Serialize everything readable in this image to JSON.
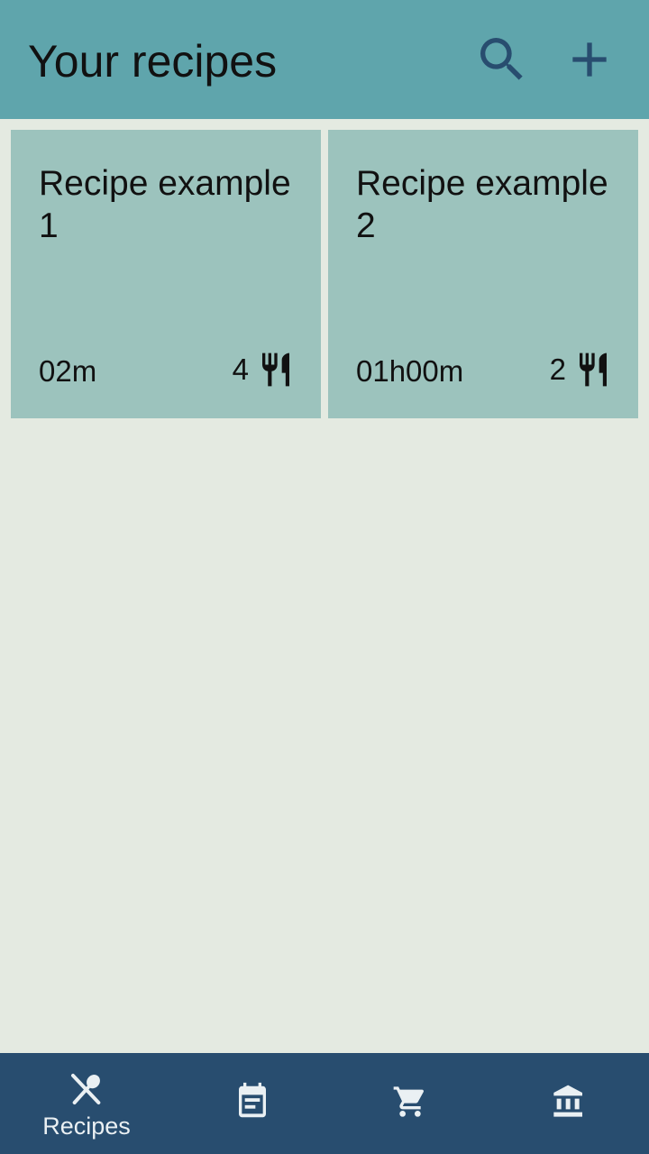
{
  "header": {
    "title": "Your recipes",
    "search_icon": "search-icon",
    "add_icon": "plus-icon"
  },
  "recipes": [
    {
      "name": "Recipe example 1",
      "time": "02m",
      "servings": "4",
      "servings_icon": "fork-knife-icon"
    },
    {
      "name": "Recipe example 2",
      "time": "01h00m",
      "servings": "2",
      "servings_icon": "fork-knife-icon"
    }
  ],
  "bottom_nav": {
    "items": [
      {
        "label": "Recipes",
        "icon": "spoon-knife-icon",
        "active": true
      },
      {
        "label": "",
        "icon": "planner-icon",
        "active": false
      },
      {
        "label": "",
        "icon": "cart-icon",
        "active": false
      },
      {
        "label": "",
        "icon": "bank-icon",
        "active": false
      }
    ]
  },
  "colors": {
    "topbar": "#5fa5ac",
    "card": "#9cc3bd",
    "background": "#e4eae1",
    "bottom_nav": "#284d6f",
    "header_icon": "#284d6f",
    "nav_icon": "#eaf0f3"
  }
}
